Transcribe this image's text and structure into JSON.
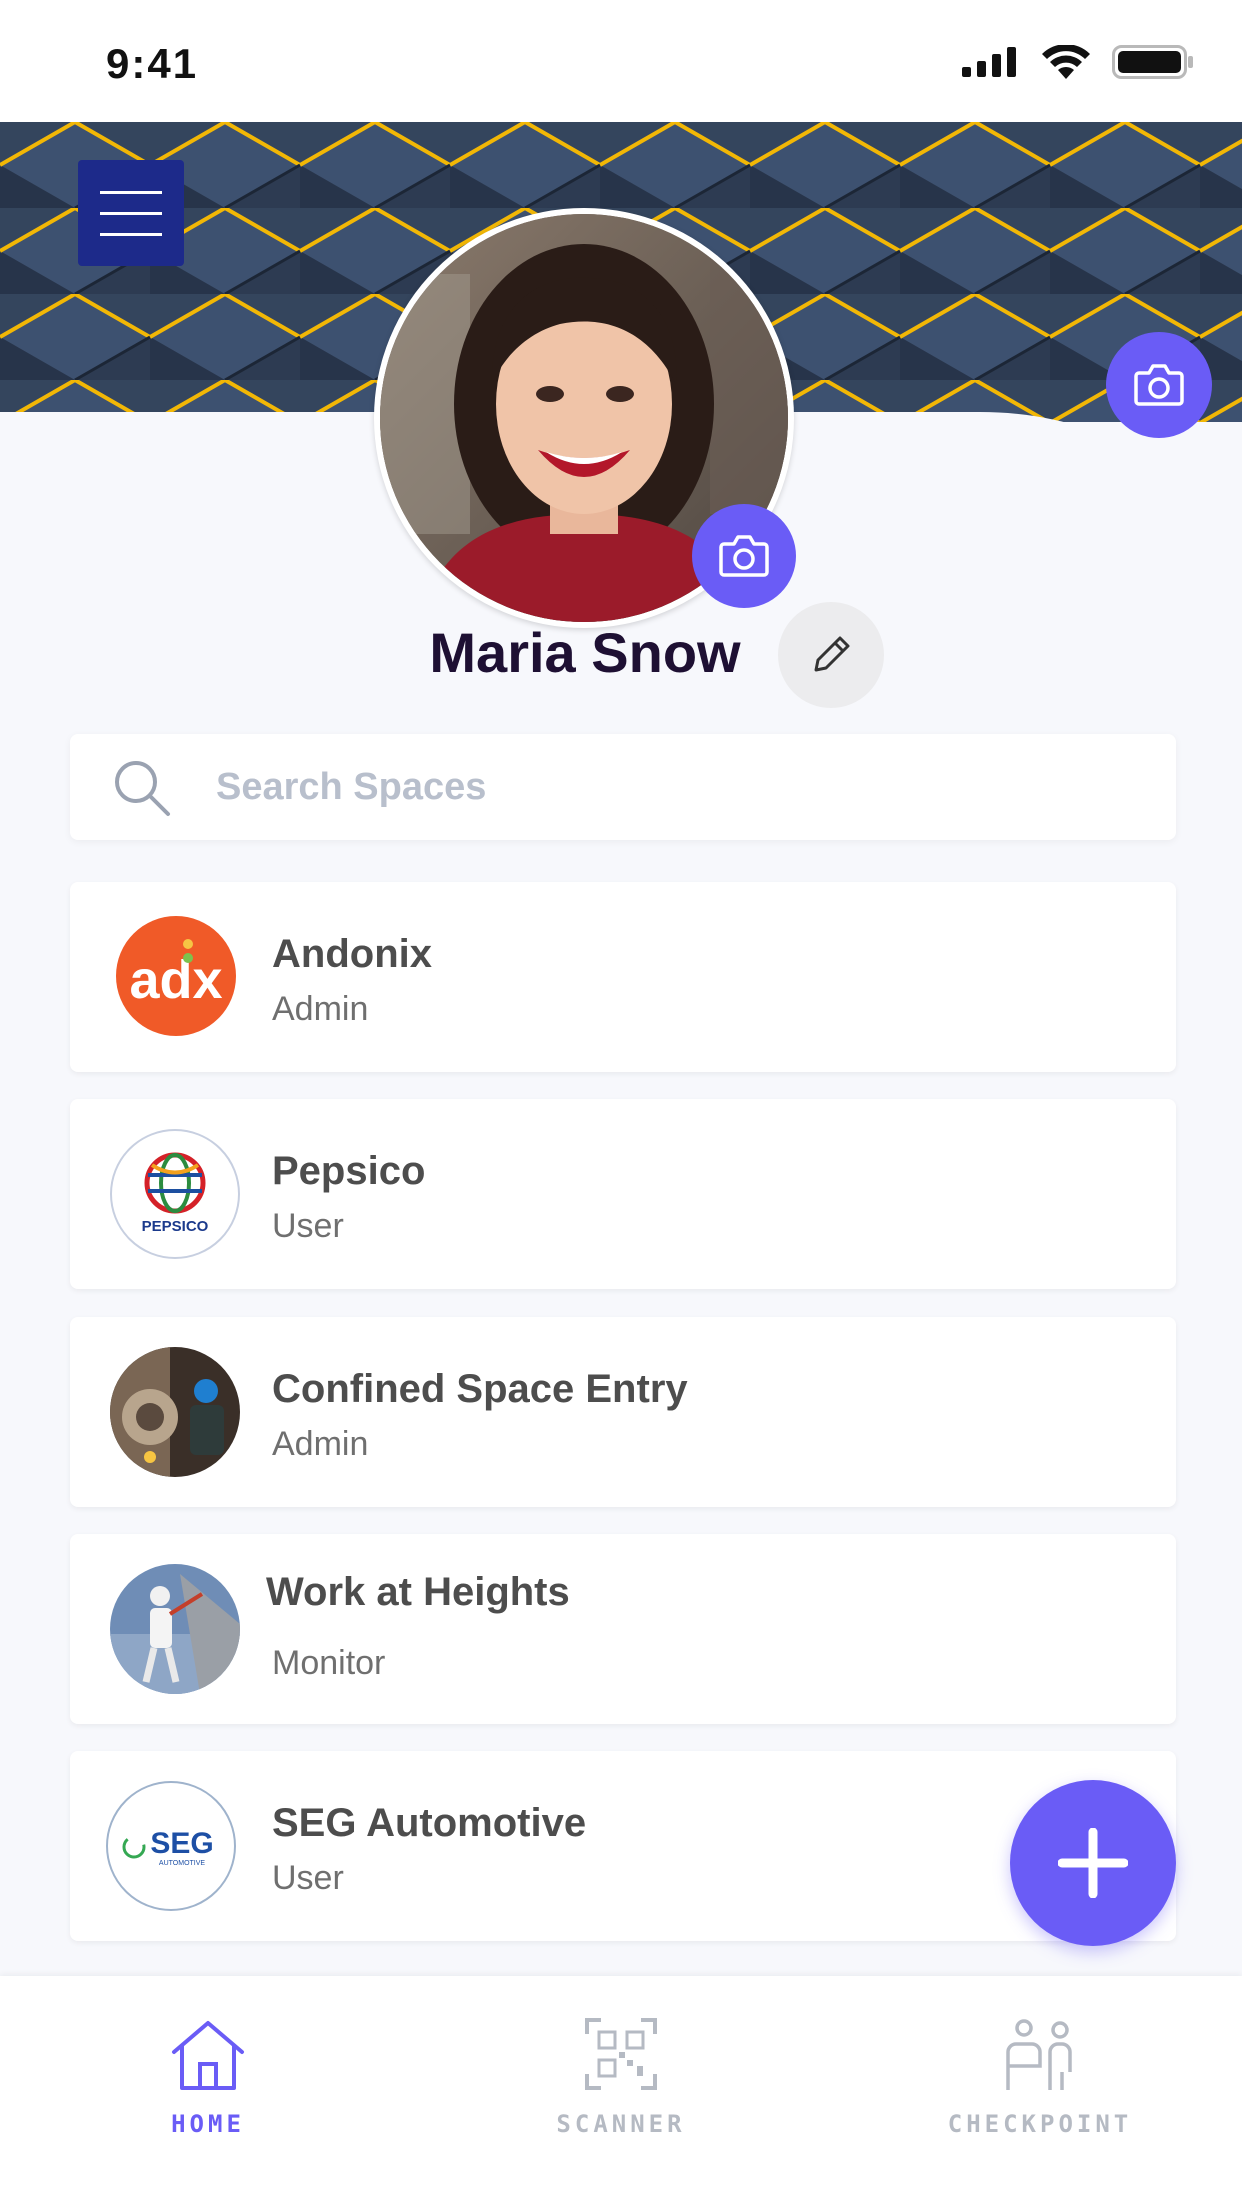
{
  "status_bar": {
    "time": "9:41"
  },
  "profile": {
    "name": "Maria Snow"
  },
  "search": {
    "placeholder": "Search Spaces"
  },
  "spaces": [
    {
      "name": "Andonix",
      "role": "Admin"
    },
    {
      "name": "Pepsico",
      "role": "User",
      "logo_text": "PEPSICO"
    },
    {
      "name": "Confined Space Entry",
      "role": "Admin"
    },
    {
      "name": "Work at Heights",
      "role": "Monitor"
    },
    {
      "name": "SEG Automotive",
      "role": "User",
      "logo_text": "SEG",
      "logo_subtext": "AUTOMOTIVE"
    }
  ],
  "nav": {
    "home": "HOME",
    "scanner": "SCANNER",
    "checkpoint": "CHECKPOINT"
  },
  "colors": {
    "accent": "#6a5cf6",
    "menu_button": "#1d2a8a",
    "andonix": "#f05a28",
    "nav_active": "#6a5cf6",
    "nav_inactive": "#b5bac3"
  },
  "icons": {
    "menu": "hamburger-icon",
    "camera": "camera-icon",
    "edit": "pencil-icon",
    "search": "search-icon",
    "add": "plus-icon",
    "home": "home-icon",
    "scanner": "qr-code-icon",
    "checkpoint": "people-icon"
  }
}
